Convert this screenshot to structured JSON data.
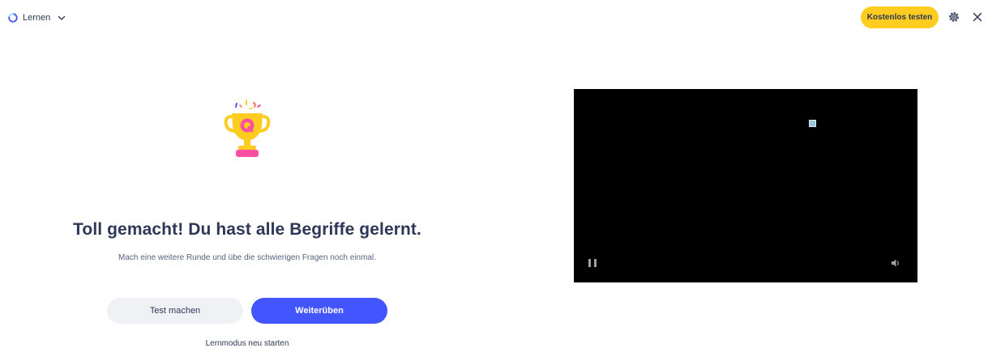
{
  "topbar": {
    "mode_label": "Lernen",
    "mode_icon": "learn-mode-icon",
    "cta_label": "Kostenlos testen",
    "settings_icon": "gear-icon",
    "close_icon": "close-icon"
  },
  "completion": {
    "trophy_icon": "trophy-icon",
    "headline": "Toll gemacht! Du hast alle Begriffe gelernt.",
    "subline": "Mach eine weitere Runde und übe die schwierigen Fragen noch einmal.",
    "test_button": "Test machen",
    "continue_button": "Weiterüben",
    "restart_link": "Lernmodus neu starten"
  },
  "video": {
    "pause_icon": "pause-icon",
    "volume_icon": "volume-icon"
  },
  "colors": {
    "accent": "#4255ff",
    "cta": "#ffcd1f",
    "text": "#2e3856",
    "video_bg": "#000000"
  }
}
